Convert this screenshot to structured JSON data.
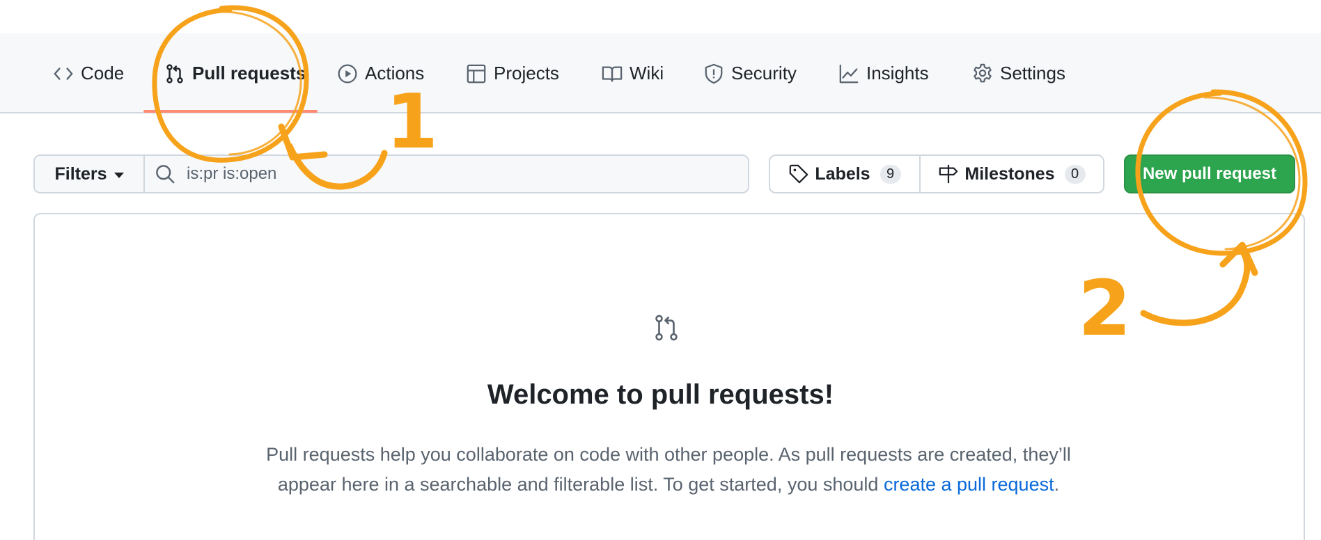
{
  "nav": {
    "tabs": [
      {
        "label": "Code",
        "icon": "code-icon"
      },
      {
        "label": "Pull requests",
        "icon": "git-pull-request-icon",
        "active": true
      },
      {
        "label": "Actions",
        "icon": "play-icon"
      },
      {
        "label": "Projects",
        "icon": "table-icon"
      },
      {
        "label": "Wiki",
        "icon": "book-icon"
      },
      {
        "label": "Security",
        "icon": "shield-icon"
      },
      {
        "label": "Insights",
        "icon": "graph-icon"
      },
      {
        "label": "Settings",
        "icon": "gear-icon"
      }
    ]
  },
  "toolbar": {
    "filters_label": "Filters",
    "search_value": "is:pr is:open",
    "labels_label": "Labels",
    "labels_count": "9",
    "milestones_label": "Milestones",
    "milestones_count": "0",
    "new_pr_label": "New pull request"
  },
  "blankslate": {
    "icon": "git-pull-request-icon",
    "title": "Welcome to pull requests!",
    "text_before": "Pull requests help you collaborate on code with other people. As pull requests are created, they’ll appear here in a searchable and filterable list. To get started, you should ",
    "link_text": "create a pull request",
    "text_after": "."
  },
  "annotations": {
    "step_1": "1",
    "step_2": "2",
    "color": "#f7a21b"
  },
  "colors": {
    "accent_green": "#2da44e",
    "active_underline": "#fd8c73",
    "link_blue": "#0969da"
  }
}
